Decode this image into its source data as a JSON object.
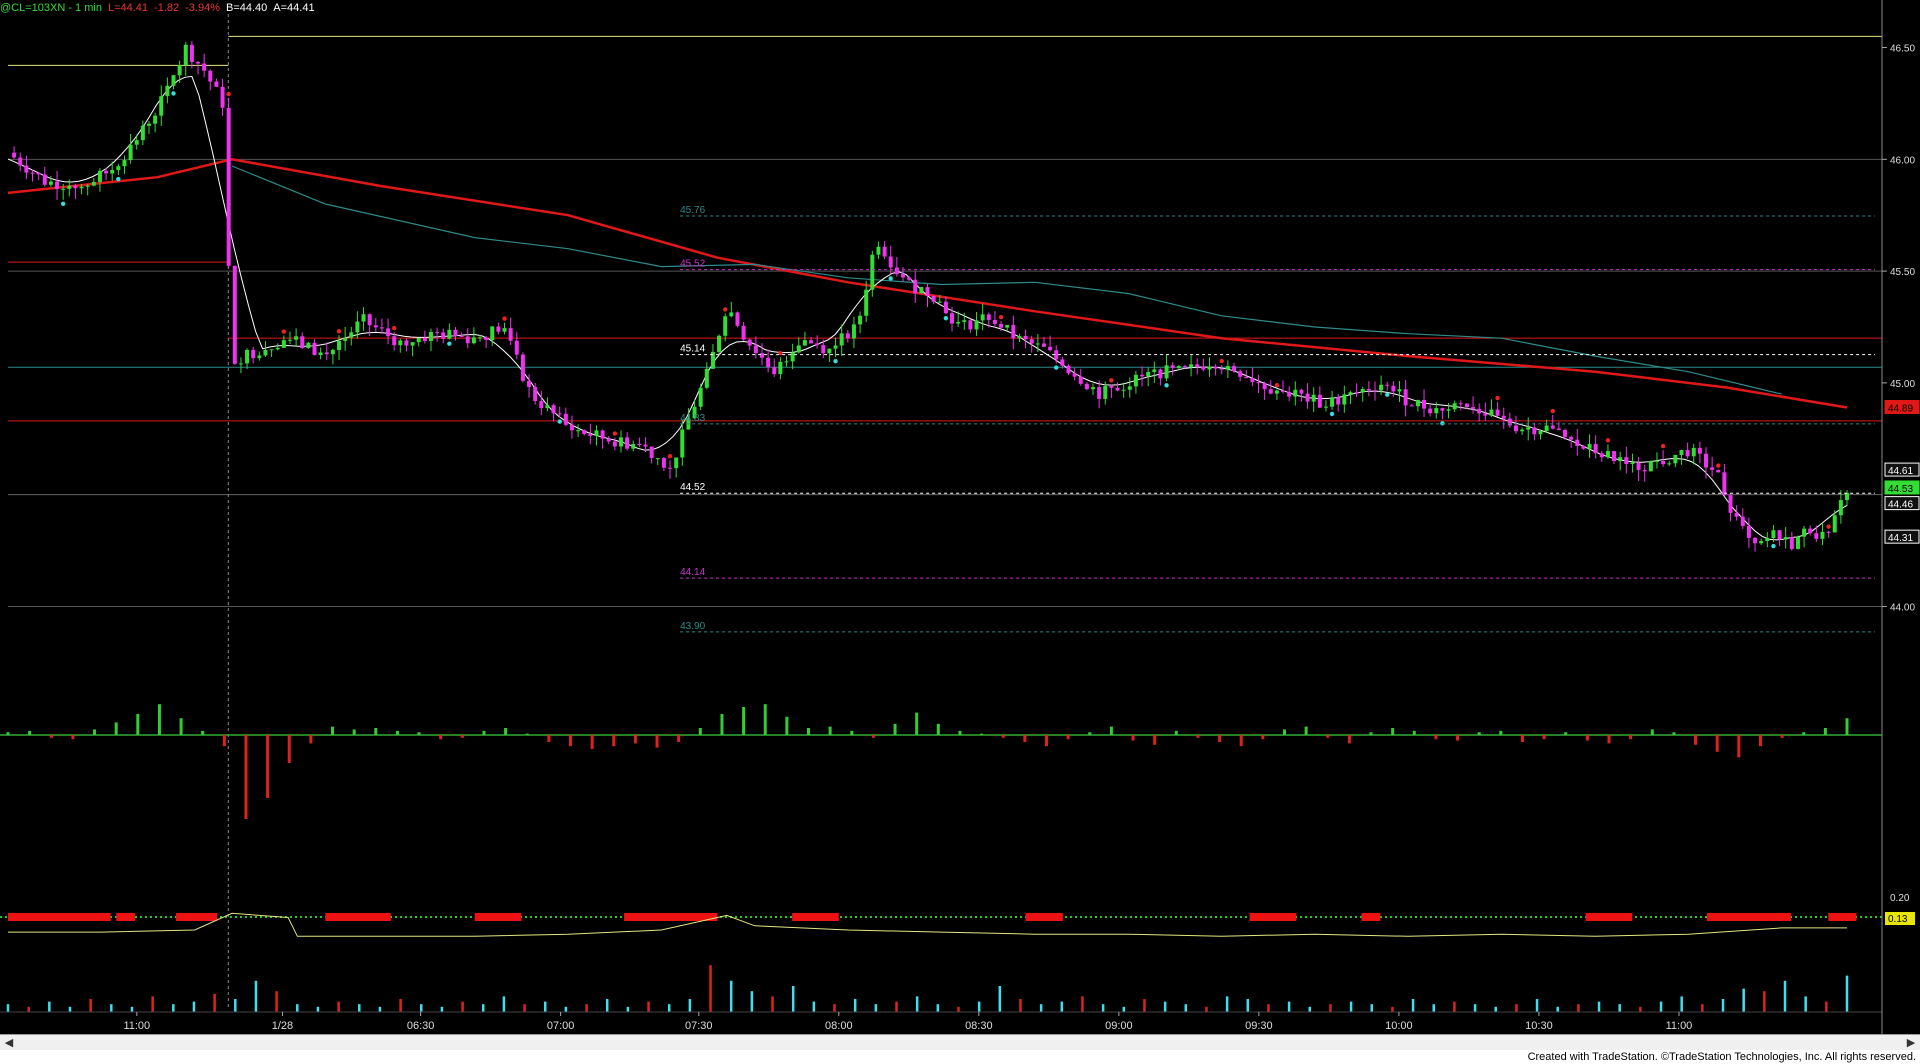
{
  "header": {
    "symbol": "@CL=103XN - 1 min",
    "last": "L=44.41",
    "change": "-1.82",
    "change_pct": "-3.94%",
    "bid": "B=44.40",
    "ask": "A=44.41"
  },
  "colors": {
    "background": "#000000",
    "up_candle": "#33dd33",
    "down_candle": "#ee33ee",
    "ema_red": "#e01818",
    "vwap_teal": "#2f8a8a",
    "fast_ma": "#ffffff",
    "level_yellow": "#e6e680",
    "histogram_up": "#33cc33",
    "histogram_down": "#dd2222",
    "dot_cyan": "#33dddd",
    "dot_red": "#ee2222",
    "volume_up": "#44ddee",
    "volume_down": "#dd2222"
  },
  "chart_data": {
    "type": "candlestick",
    "title": "@CL=103XN - 1 min",
    "ylim": [
      43.85,
      46.65
    ],
    "y_ticks": [
      "46.50",
      "46.00",
      "45.50",
      "45.00",
      "44.00"
    ],
    "x_ticks": [
      "11:00",
      "1/28",
      "06:30",
      "07:00",
      "07:30",
      "08:00",
      "08:30",
      "09:00",
      "09:30",
      "10:00",
      "10:30",
      "11:00"
    ],
    "axis_badges": [
      {
        "label": "44.89",
        "value": 44.89,
        "color": "#e01818"
      },
      {
        "label": "44.61",
        "value": 44.61,
        "color": "#ffffff"
      },
      {
        "label": "44.53",
        "value": 44.53,
        "color": "#33dd33"
      },
      {
        "label": "44.46",
        "value": 44.46,
        "color": "#ffffff"
      },
      {
        "label": "44.31",
        "value": 44.31,
        "color": "#ffffff"
      }
    ],
    "level_labels": [
      {
        "label": "45.76",
        "value": 45.76,
        "color": "#2f8a8a"
      },
      {
        "label": "45.52",
        "value": 45.52,
        "color": "#cc33cc"
      },
      {
        "label": "45.14",
        "value": 45.14,
        "color": "#ffffff"
      },
      {
        "label": "44.83",
        "value": 44.83,
        "color": "#2f8a8a"
      },
      {
        "label": "44.52",
        "value": 44.52,
        "color": "#ffffff"
      },
      {
        "label": "44.14",
        "value": 44.14,
        "color": "#cc33cc"
      },
      {
        "label": "43.90",
        "value": 43.9,
        "color": "#2f8a8a"
      }
    ],
    "horizontal_levels": [
      {
        "value": 46.55,
        "color": "#e6e680",
        "from": 0.118
      },
      {
        "value": 46.42,
        "color": "#e6e680",
        "from": 0.0,
        "to": 0.118
      },
      {
        "value": 45.54,
        "color": "#e01818",
        "from": 0.0,
        "to": 0.118
      },
      {
        "value": 45.2,
        "color": "#e01818",
        "from": 0.118
      },
      {
        "value": 45.07,
        "color": "#2f8a8a",
        "from": 0.0
      },
      {
        "value": 44.83,
        "color": "#e01818",
        "from": 0.0
      },
      {
        "value": 44.5,
        "color": "#666666",
        "from": 0.0
      },
      {
        "value": 46.0,
        "color": "#555555",
        "from": 0.0
      },
      {
        "value": 45.5,
        "color": "#555555",
        "from": 0.0
      },
      {
        "value": 44.0,
        "color": "#555555",
        "from": 0.0
      }
    ],
    "close_path": [
      [
        0.0,
        46.03
      ],
      [
        0.02,
        45.9
      ],
      [
        0.04,
        45.88
      ],
      [
        0.055,
        45.95
      ],
      [
        0.07,
        46.1
      ],
      [
        0.085,
        46.3
      ],
      [
        0.095,
        46.5
      ],
      [
        0.105,
        46.4
      ],
      [
        0.115,
        46.25
      ],
      [
        0.12,
        45.1
      ],
      [
        0.135,
        45.15
      ],
      [
        0.15,
        45.2
      ],
      [
        0.17,
        45.12
      ],
      [
        0.19,
        45.28
      ],
      [
        0.21,
        45.18
      ],
      [
        0.23,
        45.22
      ],
      [
        0.25,
        45.2
      ],
      [
        0.265,
        45.25
      ],
      [
        0.28,
        44.95
      ],
      [
        0.3,
        44.8
      ],
      [
        0.32,
        44.75
      ],
      [
        0.34,
        44.72
      ],
      [
        0.355,
        44.62
      ],
      [
        0.365,
        44.85
      ],
      [
        0.375,
        45.05
      ],
      [
        0.385,
        45.35
      ],
      [
        0.395,
        45.2
      ],
      [
        0.41,
        45.05
      ],
      [
        0.425,
        45.2
      ],
      [
        0.44,
        45.15
      ],
      [
        0.455,
        45.25
      ],
      [
        0.465,
        45.65
      ],
      [
        0.48,
        45.45
      ],
      [
        0.495,
        45.4
      ],
      [
        0.51,
        45.25
      ],
      [
        0.525,
        45.3
      ],
      [
        0.54,
        45.2
      ],
      [
        0.555,
        45.15
      ],
      [
        0.57,
        45.05
      ],
      [
        0.585,
        44.95
      ],
      [
        0.6,
        45.0
      ],
      [
        0.615,
        45.05
      ],
      [
        0.63,
        45.05
      ],
      [
        0.645,
        45.1
      ],
      [
        0.66,
        45.05
      ],
      [
        0.675,
        44.98
      ],
      [
        0.69,
        44.95
      ],
      [
        0.705,
        44.9
      ],
      [
        0.72,
        44.95
      ],
      [
        0.735,
        45.0
      ],
      [
        0.75,
        44.92
      ],
      [
        0.765,
        44.88
      ],
      [
        0.78,
        44.92
      ],
      [
        0.795,
        44.85
      ],
      [
        0.81,
        44.8
      ],
      [
        0.825,
        44.8
      ],
      [
        0.84,
        44.72
      ],
      [
        0.855,
        44.68
      ],
      [
        0.87,
        44.62
      ],
      [
        0.885,
        44.65
      ],
      [
        0.9,
        44.7
      ],
      [
        0.915,
        44.6
      ],
      [
        0.925,
        44.4
      ],
      [
        0.935,
        44.25
      ],
      [
        0.945,
        44.32
      ],
      [
        0.955,
        44.28
      ],
      [
        0.965,
        44.35
      ],
      [
        0.975,
        44.3
      ],
      [
        0.985,
        44.53
      ]
    ],
    "series": [
      {
        "name": "",
        "kind": "ema",
        "points": [
          [
            0.0,
            45.85
          ],
          [
            0.08,
            45.92
          ],
          [
            0.12,
            46.0
          ],
          [
            0.2,
            45.88
          ],
          [
            0.3,
            45.75
          ],
          [
            0.38,
            45.56
          ],
          [
            0.45,
            45.45
          ],
          [
            0.55,
            45.32
          ],
          [
            0.65,
            45.2
          ],
          [
            0.75,
            45.12
          ],
          [
            0.85,
            45.05
          ],
          [
            0.92,
            44.98
          ],
          [
            0.985,
            44.89
          ]
        ]
      },
      {
        "name": "",
        "kind": "vwap",
        "points": [
          [
            0.12,
            45.97
          ],
          [
            0.17,
            45.8
          ],
          [
            0.25,
            45.65
          ],
          [
            0.3,
            45.6
          ],
          [
            0.35,
            45.52
          ],
          [
            0.4,
            45.53
          ],
          [
            0.45,
            45.47
          ],
          [
            0.5,
            45.44
          ],
          [
            0.55,
            45.45
          ],
          [
            0.6,
            45.4
          ],
          [
            0.65,
            45.3
          ],
          [
            0.7,
            45.25
          ],
          [
            0.75,
            45.22
          ],
          [
            0.8,
            45.2
          ],
          [
            0.85,
            45.12
          ],
          [
            0.9,
            45.05
          ],
          [
            0.95,
            44.95
          ]
        ]
      }
    ],
    "macd_histogram": [
      0.2,
      0.3,
      -0.2,
      -0.3,
      0.4,
      0.9,
      1.5,
      2.2,
      1.2,
      0.3,
      -0.8,
      -6.0,
      -4.5,
      -2.0,
      -0.6,
      0.6,
      0.4,
      0.5,
      0.3,
      0.2,
      -0.3,
      -0.2,
      0.3,
      0.5,
      0.1,
      -0.5,
      -0.8,
      -1.0,
      -0.8,
      -0.6,
      -0.9,
      -0.5,
      0.5,
      1.5,
      2.0,
      2.2,
      1.3,
      0.5,
      0.6,
      0.3,
      -0.2,
      0.8,
      1.6,
      0.8,
      0.3,
      0.1,
      -0.2,
      -0.5,
      -0.8,
      -0.3,
      0.2,
      0.6,
      -0.4,
      -0.7,
      0.3,
      -0.2,
      -0.5,
      -0.8,
      -0.3,
      0.4,
      0.6,
      -0.2,
      -0.6,
      0.2,
      0.5,
      0.3,
      -0.3,
      -0.4,
      0.2,
      0.3,
      -0.5,
      -0.3,
      0.2,
      -0.4,
      -0.6,
      -0.3,
      0.4,
      0.2,
      -0.7,
      -1.2,
      -1.6,
      -0.8,
      -0.2,
      0.2,
      0.5,
      1.2
    ],
    "adx_axis": [
      "0.20",
      "0.13"
    ],
    "adx_line": [
      [
        0.0,
        0.11
      ],
      [
        0.05,
        0.11
      ],
      [
        0.1,
        0.12
      ],
      [
        0.12,
        0.2
      ],
      [
        0.15,
        0.18
      ],
      [
        0.155,
        0.09
      ],
      [
        0.25,
        0.09
      ],
      [
        0.3,
        0.1
      ],
      [
        0.35,
        0.12
      ],
      [
        0.385,
        0.19
      ],
      [
        0.4,
        0.14
      ],
      [
        0.45,
        0.12
      ],
      [
        0.5,
        0.11
      ],
      [
        0.55,
        0.1
      ],
      [
        0.6,
        0.1
      ],
      [
        0.65,
        0.09
      ],
      [
        0.7,
        0.1
      ],
      [
        0.75,
        0.09
      ],
      [
        0.8,
        0.1
      ],
      [
        0.85,
        0.09
      ],
      [
        0.9,
        0.1
      ],
      [
        0.95,
        0.13
      ],
      [
        0.985,
        0.13
      ]
    ],
    "adx_bars": [
      [
        0.0,
        0.055
      ],
      [
        0.058,
        0.068
      ],
      [
        0.09,
        0.112
      ],
      [
        0.17,
        0.205
      ],
      [
        0.25,
        0.275
      ],
      [
        0.33,
        0.38
      ],
      [
        0.42,
        0.445
      ],
      [
        0.545,
        0.565
      ],
      [
        0.665,
        0.69
      ],
      [
        0.725,
        0.735
      ],
      [
        0.845,
        0.87
      ],
      [
        0.91,
        0.955
      ],
      [
        0.975,
        0.99
      ]
    ],
    "volume": [
      3,
      2,
      4,
      2,
      5,
      3,
      2,
      6,
      3,
      4,
      7,
      5,
      12,
      8,
      3,
      2,
      4,
      3,
      2,
      5,
      3,
      2,
      4,
      3,
      6,
      3,
      4,
      2,
      3,
      5,
      2,
      4,
      3,
      5,
      18,
      12,
      8,
      6,
      10,
      4,
      3,
      5,
      3,
      4,
      6,
      3,
      2,
      4,
      10,
      5,
      3,
      4,
      6,
      3,
      2,
      5,
      4,
      3,
      2,
      6,
      5,
      3,
      4,
      2,
      3,
      4,
      3,
      2,
      5,
      3,
      4,
      3,
      2,
      3,
      5,
      2,
      3,
      4,
      3,
      2,
      4,
      6,
      3,
      5,
      9,
      8,
      12,
      6,
      4,
      14
    ]
  }
}
